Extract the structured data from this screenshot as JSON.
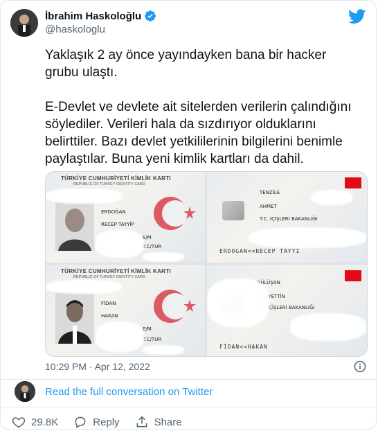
{
  "author": {
    "name": "İbrahim Haskoloğlu",
    "handle": "@haskologlu",
    "verified": true
  },
  "tweet": {
    "paragraph_1": "Yaklaşık 2 ay önce yayındayken bana bir hacker grubu ulaştı.",
    "paragraph_2": "E-Devlet ve devlete ait sitelerden verilerin çalındığını söylediler. Verileri hala da sızdırıyor olduklarını belirttiler. Bazı devlet yetkililerinin bilgilerini benimle paylaştılar. Buna yeni kimlik kartları da dahil."
  },
  "media": {
    "card1": {
      "title": "TÜRKİYE CUMHURİYETİ KİMLİK KARTI",
      "subtitle": "REPUBLIC OF TURKEY IDENTITY CARD",
      "surname": "ERDOĞAN",
      "given": "RECEP TAYYİP",
      "sex": "E/M",
      "nationality": "T.C/TUR"
    },
    "card2": {
      "surname": "TENZİLE",
      "given": "AHMET",
      "authority": "T.C. İÇİŞLERİ BAKANLIĞI",
      "mrz": "ERDOGAN<<RECEP TAYYI"
    },
    "card3": {
      "title": "TÜRKİYE CUMHURİYETİ KİMLİK KARTI",
      "subtitle": "REPUBLIC OF TURKEY IDENTITY CARD",
      "surname": "FİDAN",
      "given": "HAKAN",
      "sex": "E/M",
      "nationality": "T.C/TUR"
    },
    "card4": {
      "surname": "GÜLÜŞAN",
      "given": "MUHYETTİN",
      "authority": "T.C. İÇİŞLERİ BAKANLIĞI",
      "mrz": "FİDAN<<HAKAN"
    }
  },
  "timestamp": "10:29 PM · Apr 12, 2022",
  "read_full": "Read the full conversation on Twitter",
  "actions": {
    "likes": "29.8K",
    "reply": "Reply",
    "share": "Share"
  },
  "colors": {
    "twitter_blue": "#1d9bf0",
    "like_red": "#f91880",
    "secondary_text": "#536471"
  },
  "icons": [
    "twitter-logo-icon",
    "verified-badge-icon",
    "info-icon",
    "heart-icon",
    "reply-icon",
    "share-icon"
  ]
}
